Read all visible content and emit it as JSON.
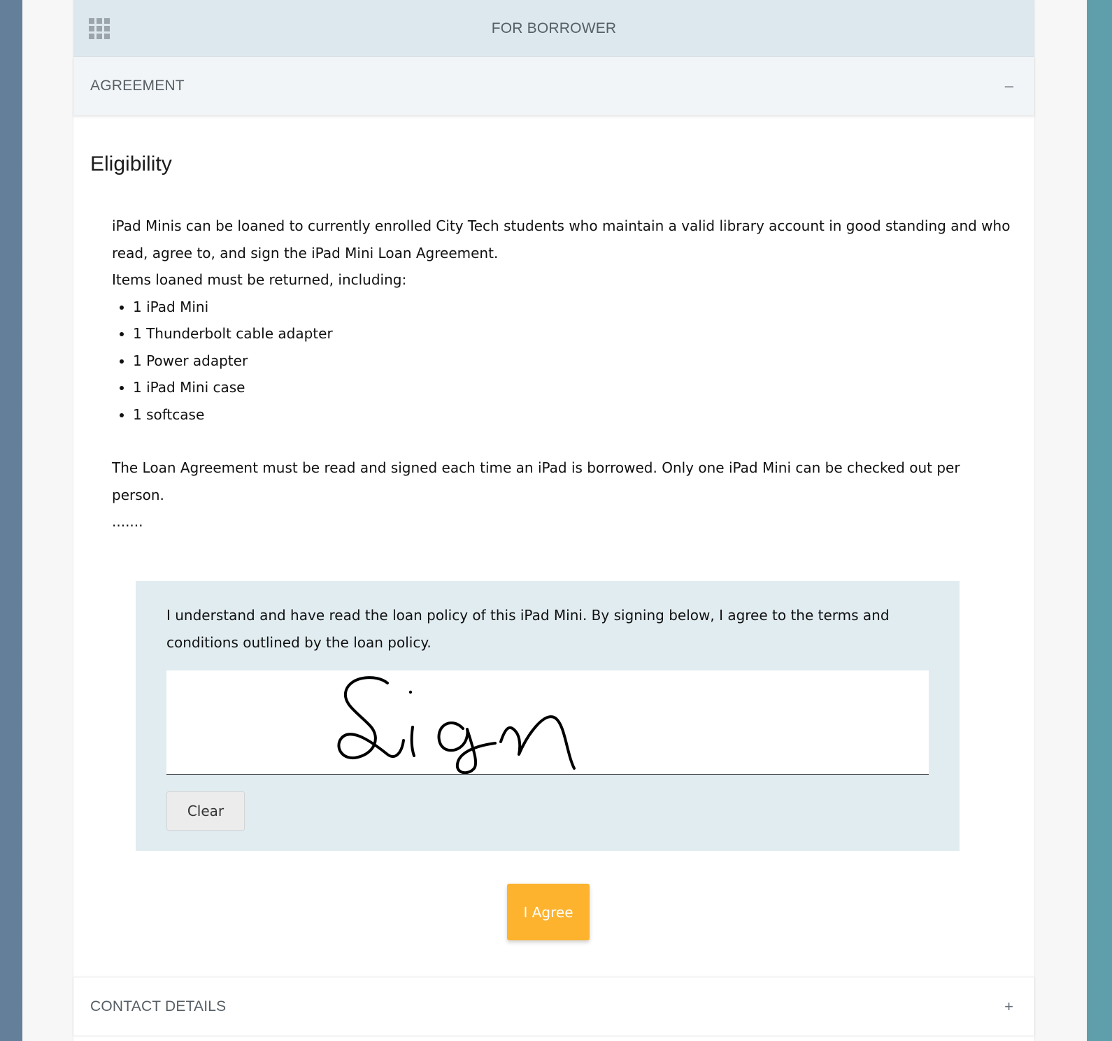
{
  "topbar": {
    "title": "FOR BORROWER",
    "menu_icon": "grid-menu-icon"
  },
  "sections": {
    "agreement": {
      "title": "AGREEMENT",
      "toggle": "–",
      "state": "expanded"
    },
    "contact": {
      "title": "CONTACT DETAILS",
      "toggle": "+",
      "state": "collapsed"
    }
  },
  "agreement": {
    "heading": "Eligibility",
    "intro": "iPad Minis can be loaned to currently enrolled City Tech students who maintain a valid library account in good standing and who read, agree to, and sign the iPad Mini Loan Agreement.",
    "items_intro": "Items loaned must be returned, including:",
    "items": [
      "1 iPad Mini",
      "1 Thunderbolt cable adapter",
      "1 Power adapter",
      "1 iPad Mini case",
      "1 softcase"
    ],
    "note": "The Loan Agreement must be read and signed each time an iPad is borrowed. Only one iPad Mini can be checked out per person.",
    "ellipsis": "......."
  },
  "signature": {
    "statement": "I understand and have read the loan policy of this iPad Mini. By signing below, I agree to the terms and conditions outlined by the loan policy.",
    "signed_text": "Sign",
    "clear_label": "Clear"
  },
  "actions": {
    "agree_label": "I Agree"
  },
  "colors": {
    "topbar_bg": "#dde8ee",
    "accordion_bg": "#f2f5f7",
    "sign_panel_bg": "#e1ecf1",
    "agree_button": "#fdb32e"
  }
}
